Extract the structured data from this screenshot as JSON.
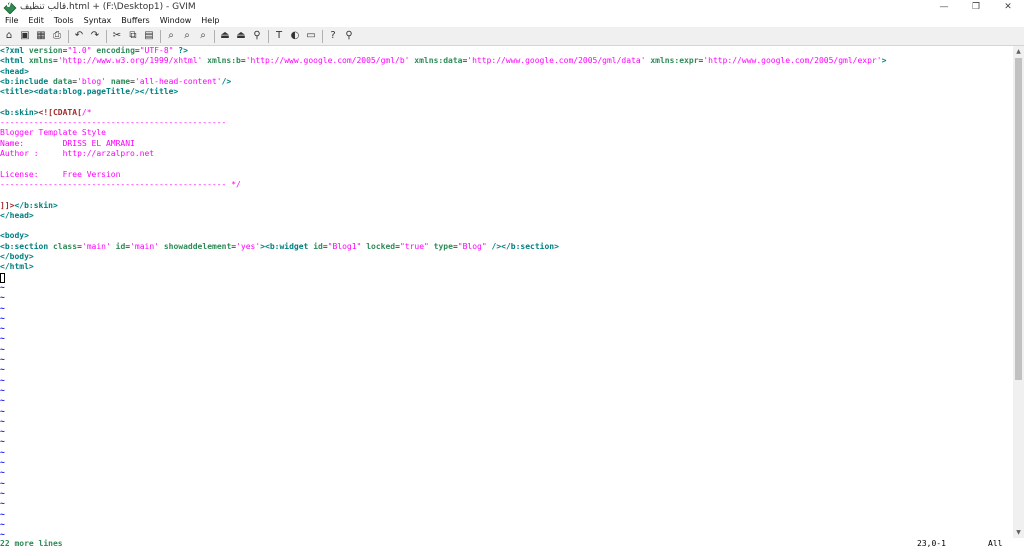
{
  "window": {
    "title": "قالب تنظيف.html + (F:\\Desktop1) - GVIM",
    "controls": {
      "minimize": "—",
      "restore": "❐",
      "close": "✕"
    }
  },
  "menu": [
    "File",
    "Edit",
    "Tools",
    "Syntax",
    "Buffers",
    "Window",
    "Help"
  ],
  "toolbar": {
    "groups": [
      [
        {
          "name": "open-icon",
          "glyph": "⌂"
        },
        {
          "name": "save-icon",
          "glyph": "▣"
        },
        {
          "name": "save-all-icon",
          "glyph": "▦"
        },
        {
          "name": "print-icon",
          "glyph": "⎙"
        }
      ],
      [
        {
          "name": "undo-icon",
          "glyph": "↶"
        },
        {
          "name": "redo-icon",
          "glyph": "↷"
        }
      ],
      [
        {
          "name": "cut-icon",
          "glyph": "✂"
        },
        {
          "name": "copy-icon",
          "glyph": "⧉"
        },
        {
          "name": "paste-icon",
          "glyph": "▤"
        }
      ],
      [
        {
          "name": "find-icon",
          "glyph": "⌕"
        },
        {
          "name": "find-next-icon",
          "glyph": "⌕"
        },
        {
          "name": "find-prev-icon",
          "glyph": "⌕"
        }
      ],
      [
        {
          "name": "load-session-icon",
          "glyph": "⏏"
        },
        {
          "name": "save-session-icon",
          "glyph": "⏏"
        },
        {
          "name": "run-script-icon",
          "glyph": "⚲"
        }
      ],
      [
        {
          "name": "make-icon",
          "glyph": "T"
        },
        {
          "name": "build-tags-icon",
          "glyph": "◐"
        },
        {
          "name": "jump-tag-icon",
          "glyph": "▭"
        }
      ],
      [
        {
          "name": "help-icon",
          "glyph": "?"
        },
        {
          "name": "find-help-icon",
          "glyph": "⚲"
        }
      ]
    ]
  },
  "editor": {
    "lines": [
      [
        [
          "t-tag",
          "<?xml "
        ],
        [
          "t-attr",
          "version"
        ],
        [
          "t-text",
          "="
        ],
        [
          "t-str",
          "\"1.0\""
        ],
        [
          "t-text",
          " "
        ],
        [
          "t-attr",
          "encoding"
        ],
        [
          "t-text",
          "="
        ],
        [
          "t-str",
          "\"UTF-8\""
        ],
        [
          "t-text",
          " "
        ],
        [
          "t-tag",
          "?>"
        ]
      ],
      [
        [
          "t-tag",
          "<html "
        ],
        [
          "t-attr",
          "xmlns"
        ],
        [
          "t-text",
          "="
        ],
        [
          "t-str",
          "'http://www.w3.org/1999/xhtml'"
        ],
        [
          "t-text",
          " "
        ],
        [
          "t-attr",
          "xmlns:b"
        ],
        [
          "t-text",
          "="
        ],
        [
          "t-str",
          "'http://www.google.com/2005/gml/b'"
        ],
        [
          "t-text",
          " "
        ],
        [
          "t-attr",
          "xmlns:data"
        ],
        [
          "t-text",
          "="
        ],
        [
          "t-str",
          "'http://www.google.com/2005/gml/data'"
        ],
        [
          "t-text",
          " "
        ],
        [
          "t-attr",
          "xmlns:expr"
        ],
        [
          "t-text",
          "="
        ],
        [
          "t-str",
          "'http://www.google.com/2005/gml/expr'"
        ],
        [
          "t-tag",
          ">"
        ]
      ],
      [
        [
          "t-tag",
          "<head>"
        ]
      ],
      [
        [
          "t-tag",
          "<b:include "
        ],
        [
          "t-attr",
          "data"
        ],
        [
          "t-text",
          "="
        ],
        [
          "t-str",
          "'blog'"
        ],
        [
          "t-text",
          " "
        ],
        [
          "t-attr",
          "name"
        ],
        [
          "t-text",
          "="
        ],
        [
          "t-str",
          "'all-head-content'"
        ],
        [
          "t-tag",
          "/>"
        ]
      ],
      [
        [
          "t-tag",
          "<title><data:blog.pageTitle/></title>"
        ]
      ],
      [],
      [
        [
          "t-tag",
          "<b:skin>"
        ],
        [
          "t-special",
          "<![CDATA["
        ],
        [
          "t-comment",
          "/*"
        ]
      ],
      [
        [
          "t-comment",
          "-----------------------------------------------"
        ]
      ],
      [
        [
          "t-comment",
          "Blogger Template Style"
        ]
      ],
      [
        [
          "t-comment",
          "Name:        DRISS EL AMRANI"
        ]
      ],
      [
        [
          "t-comment",
          "Author :     http://arzalpro.net"
        ]
      ],
      [],
      [
        [
          "t-comment",
          "License:     Free Version"
        ]
      ],
      [
        [
          "t-comment",
          "----------------------------------------------- */"
        ]
      ],
      [],
      [
        [
          "t-special",
          "]]>"
        ],
        [
          "t-tag",
          "</b:skin>"
        ]
      ],
      [
        [
          "t-tag",
          "</head>"
        ]
      ],
      [],
      [
        [
          "t-tag",
          "<body>"
        ]
      ],
      [
        [
          "t-tag",
          "<b:section "
        ],
        [
          "t-attr",
          "class"
        ],
        [
          "t-text",
          "="
        ],
        [
          "t-str",
          "'main'"
        ],
        [
          "t-text",
          " "
        ],
        [
          "t-attr",
          "id"
        ],
        [
          "t-text",
          "="
        ],
        [
          "t-str",
          "'main'"
        ],
        [
          "t-text",
          " "
        ],
        [
          "t-attr",
          "showaddelement"
        ],
        [
          "t-text",
          "="
        ],
        [
          "t-str",
          "'yes'"
        ],
        [
          "t-tag",
          "><b:widget "
        ],
        [
          "t-attr",
          "id"
        ],
        [
          "t-text",
          "="
        ],
        [
          "t-str",
          "\"Blog1\""
        ],
        [
          "t-text",
          " "
        ],
        [
          "t-attr",
          "locked"
        ],
        [
          "t-text",
          "="
        ],
        [
          "t-str",
          "\"true\""
        ],
        [
          "t-text",
          " "
        ],
        [
          "t-attr",
          "type"
        ],
        [
          "t-text",
          "="
        ],
        [
          "t-str",
          "\"Blog\""
        ],
        [
          "t-text",
          " "
        ],
        [
          "t-tag",
          "/></b:section>"
        ]
      ],
      [
        [
          "t-tag",
          "</body>"
        ]
      ],
      [
        [
          "t-tag",
          "</html>"
        ]
      ]
    ],
    "cursor_line": 23,
    "tilde": "~",
    "tilde_count": 25
  },
  "scrollbar": {
    "up": "▲",
    "down": "▼"
  },
  "cmdline": {
    "message": "22 more lines",
    "position": "23,0-1",
    "percent": "All"
  }
}
